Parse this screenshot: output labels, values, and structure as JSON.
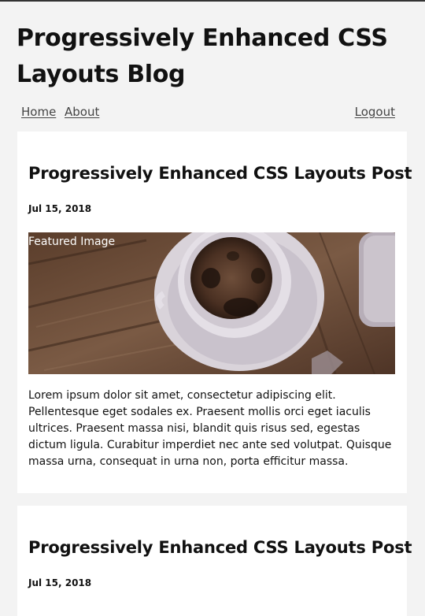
{
  "site": {
    "title": "Progressively Enhanced CSS Layouts Blog"
  },
  "nav": {
    "home": "Home",
    "about": "About",
    "logout": "Logout"
  },
  "posts": [
    {
      "title": "Progressively Enhanced CSS Layouts Post",
      "date": "Jul 15, 2018",
      "image_label": "Featured Image",
      "excerpt": "Lorem ipsum dolor sit amet, consectetur adipiscing elit. Pellentesque eget sodales ex. Praesent mollis orci eget iaculis ultrices. Praesent massa nisi, blandit quis risus sed, egestas dictum ligula. Curabitur imperdiet nec ante sed volutpat. Quisque massa urna, consequat in urna non, porta efficitur massa."
    },
    {
      "title": "Progressively Enhanced CSS Layouts Post",
      "date": "Jul 15, 2018"
    }
  ],
  "colors": {
    "page_background": "#f3f3f3",
    "card_background": "#ffffff",
    "link": "#444444"
  }
}
